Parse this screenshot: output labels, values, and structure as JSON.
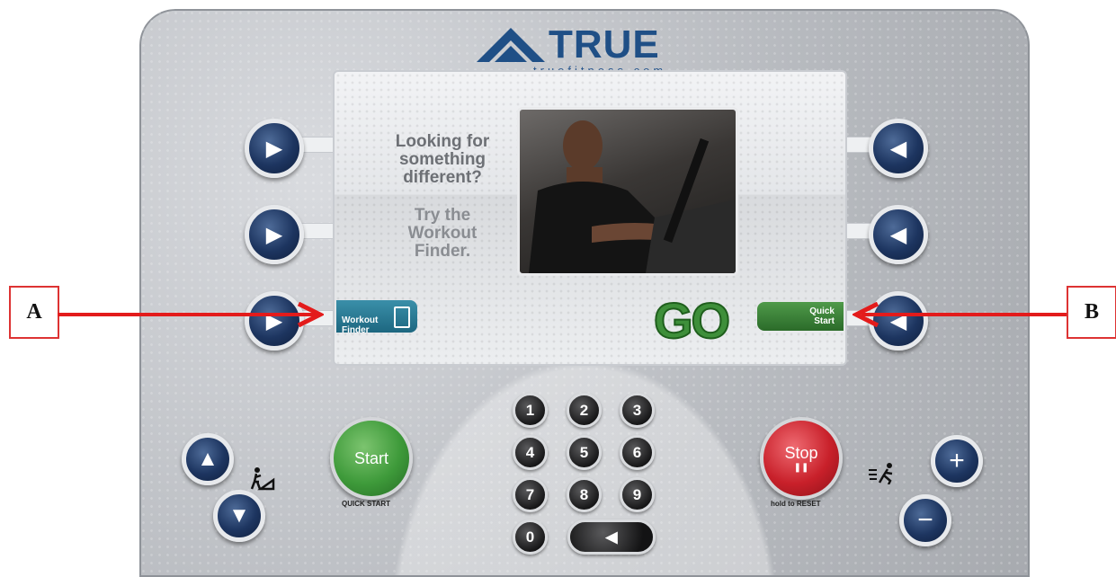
{
  "brand": {
    "name": "TRUE",
    "url": "truefitness.com"
  },
  "screen": {
    "headline": "Looking for\nsomething\ndifferent?",
    "subline": "Try the\nWorkout\nFinder.",
    "workout_finder_label": "Workout\nFinder",
    "go_label": "GO",
    "quick_start_label": "Quick\nStart"
  },
  "keypad": {
    "keys": [
      "1",
      "2",
      "3",
      "4",
      "5",
      "6",
      "7",
      "8",
      "9",
      "0"
    ]
  },
  "controls": {
    "start_label": "Start",
    "start_sub": "QUICK START",
    "stop_label": "Stop",
    "stop_sub": "hold to RESET"
  },
  "callouts": {
    "a": "A",
    "b": "B"
  },
  "colors": {
    "arrow": "#e31b1b",
    "start": "#3e9a3a",
    "stop": "#c8202a",
    "nav": "#1d3560"
  }
}
